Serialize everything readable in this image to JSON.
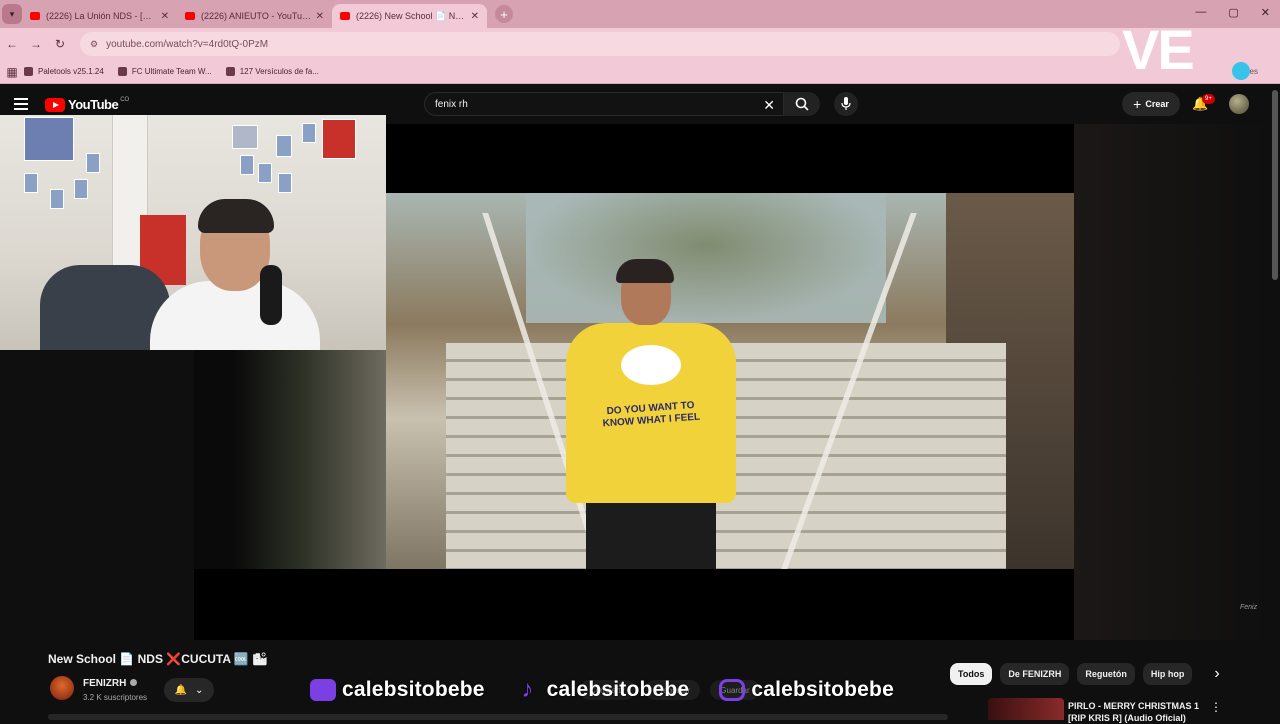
{
  "browser": {
    "tabs": [
      {
        "label": "(2226) La Unión NDS - [Video…",
        "active": false
      },
      {
        "label": "(2226) ANIEUTO - YouTube",
        "active": false
      },
      {
        "label": "(2226) New School 📄 NDS",
        "active": true
      }
    ],
    "url": "youtube.com/watch?v=4rd0tQ-0PzM",
    "bookmarks": [
      {
        "label": "Paletools v25.1.24"
      },
      {
        "label": "FC Ultimate Team W..."
      },
      {
        "label": "127 Versículos de fa..."
      }
    ],
    "bookmarks_right": "dores"
  },
  "overlay": {
    "logo_text": "VE",
    "socials": [
      {
        "platform": "twitch-icon",
        "handle": "calebsitobebe"
      },
      {
        "platform": "tiktok-icon",
        "handle": "calebsitobebe"
      },
      {
        "platform": "instagram-icon",
        "handle": "calebsitobebe"
      }
    ]
  },
  "youtube": {
    "logo_word": "YouTube",
    "country": "CO",
    "search_value": "fenix rh",
    "create_label": "Crear",
    "notif_badge": "9+",
    "video": {
      "title_prefix": "New School 📄 NDS",
      "title_x": "❌",
      "title_suffix": "CUCUTA 🆒 🏙",
      "shirt_text": "DO YOU WANT TO KNOW WHAT I FEEL",
      "watermark": "Feniz"
    },
    "channel": {
      "name": "FENIZRH",
      "subscribers": "3.2 K suscriptores"
    },
    "actions": [
      "Compartir",
      "Preguntar",
      "Guardar"
    ],
    "chips": [
      {
        "label": "Todos",
        "active": true
      },
      {
        "label": "De FENIZRH",
        "active": false
      },
      {
        "label": "Reguetón",
        "active": false
      },
      {
        "label": "Hip hop",
        "active": false
      }
    ],
    "recommended": {
      "title": "PIRLO - MERRY CHRISTMAS 1 [RIP KRIS R] (Audio Oficial)"
    }
  },
  "colors": {
    "chrome_pink": "#f2c9d6",
    "yt_red": "#ff0000",
    "overlay_purple": "#7b3fe4",
    "logo_dot": "#38c4e8"
  }
}
